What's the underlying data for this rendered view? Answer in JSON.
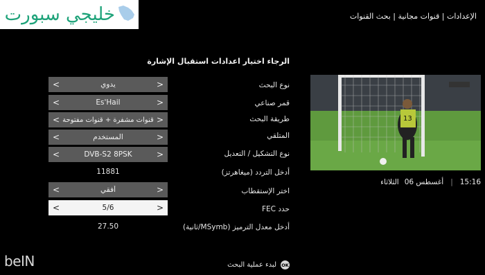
{
  "logo": {
    "text": "خليجي سبورت"
  },
  "breadcrumb": "الإعدادات | قنوات مجانية | بحث القنوات",
  "instruction": "الرجاء اختيار اعدادات استقبال الإشارة",
  "rows": [
    {
      "label": "نوع البحث",
      "value": "يدوي"
    },
    {
      "label": "قمر صناعي",
      "value": "Es'Hail"
    },
    {
      "label": "طريقة البحث",
      "value": "قنوات مشفرة + قنوات مفتوحة"
    },
    {
      "label": "المتلقي",
      "value": "المستخدم"
    },
    {
      "label": "نوع التشكيل / التعديل",
      "value": "DVB-S2 8PSK"
    },
    {
      "label": "أدخل التردد (ميغاهرتز)",
      "value": "11881"
    },
    {
      "label": "اختر الإستقطاب",
      "value": "أفقي"
    },
    {
      "label": "حدد FEC",
      "value": "5/6"
    },
    {
      "label": "أدخل معدل الترميز (MSymb/ثانية)",
      "value": "27.50"
    }
  ],
  "arrows": {
    "left": "<",
    "right": ">"
  },
  "clock": {
    "time": "15:16",
    "date": "أغسطس 06",
    "day": "الثلاثاء"
  },
  "footer": {
    "brand": "beIN",
    "ok_label": "OK",
    "start_label": "لبدء عملية البحث"
  },
  "colors": {
    "background": "#000000",
    "field": "#5a5a5a",
    "field_active": "#f4f4f4",
    "logo_text": "#1fa37a"
  }
}
